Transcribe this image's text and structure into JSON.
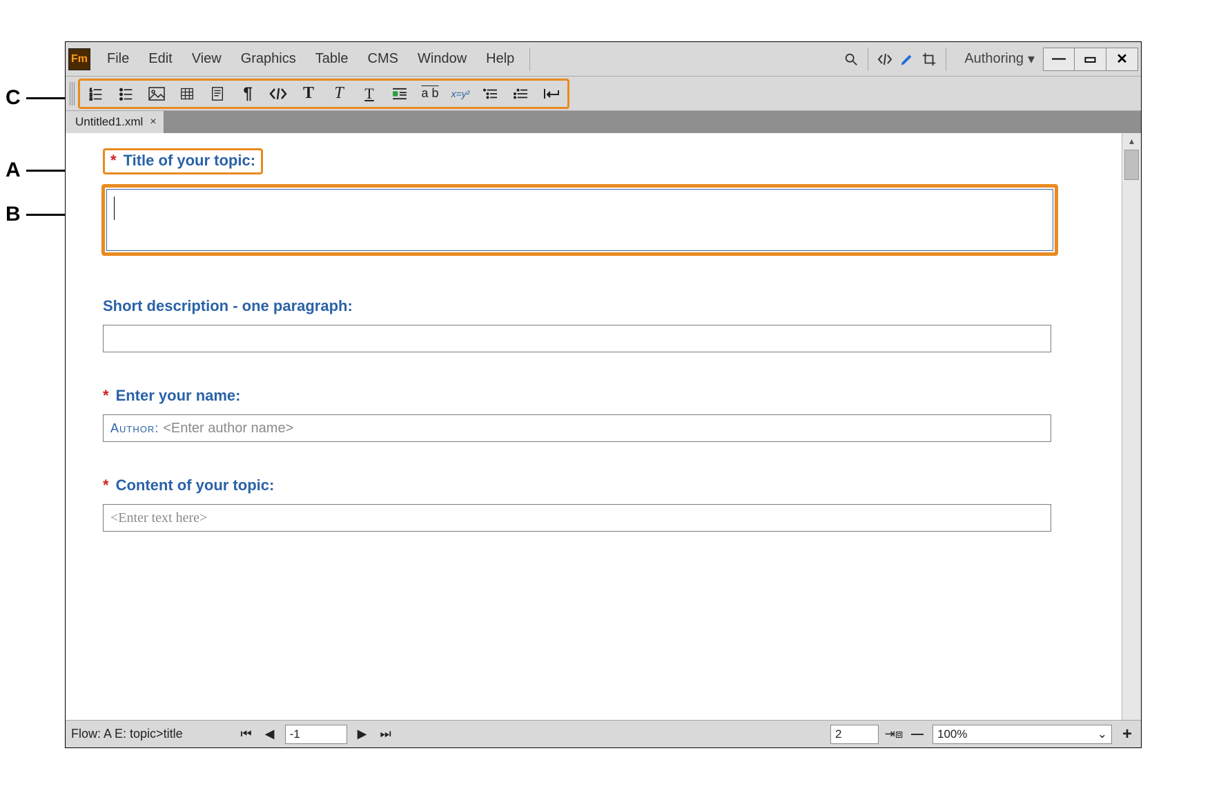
{
  "app": {
    "logo_text": "Fm"
  },
  "menu": {
    "items": [
      "File",
      "Edit",
      "View",
      "Graphics",
      "Table",
      "CMS",
      "Window",
      "Help"
    ],
    "workspace": "Authoring"
  },
  "toolbar": {
    "icons": [
      "numbered-list-icon",
      "bulleted-list-icon",
      "image-icon",
      "table-icon",
      "note-icon",
      "pilcrow-icon",
      "code-icon",
      "bold-icon",
      "italic-icon",
      "underline-icon",
      "wrap-text-icon",
      "strikethrough-icon",
      "equation-icon",
      "indent-increase-icon",
      "indent-decrease-icon",
      "insert-return-icon"
    ]
  },
  "tab": {
    "title": "Untitled1.xml"
  },
  "form": {
    "title": {
      "label": "Title of your topic:",
      "required": true,
      "value": ""
    },
    "shortdesc": {
      "label": "Short description - one paragraph:",
      "required": false,
      "value": ""
    },
    "name": {
      "label": "Enter your name:",
      "required": true,
      "prefix": "Author:",
      "placeholder": "<Enter author name>"
    },
    "content": {
      "label": "Content of your topic:",
      "required": true,
      "placeholder": "<Enter text here>"
    }
  },
  "status": {
    "flow": "Flow: A  E: topic>title",
    "page_left": "-1",
    "page_right": "2",
    "zoom": "100%"
  },
  "callouts": {
    "A": "A",
    "B": "B",
    "C": "C"
  }
}
